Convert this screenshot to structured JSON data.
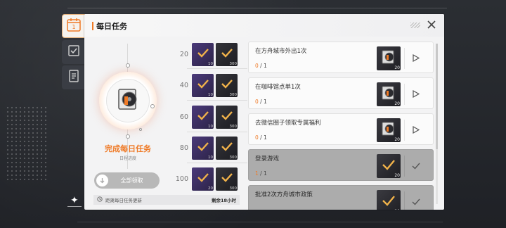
{
  "header": {
    "title": "每日任务"
  },
  "tabs": [
    {
      "name": "daily",
      "label": "1",
      "icon": "calendar-icon",
      "active": true
    },
    {
      "name": "weekly",
      "icon": "checklist-icon",
      "active": false
    },
    {
      "name": "record",
      "icon": "document-icon",
      "active": false
    }
  ],
  "left": {
    "complete_title": "完成每日任务",
    "complete_subtitle": "日程进度",
    "claim_all_label": "全部领取",
    "refresh_label": "距离每日任务更新",
    "remaining": "剩余18小时"
  },
  "milestones": [
    {
      "threshold": "20",
      "rewards": [
        {
          "style": "purple",
          "qty": "10",
          "claimed": true
        },
        {
          "style": "dark",
          "qty": "300",
          "claimed": true
        }
      ]
    },
    {
      "threshold": "40",
      "rewards": [
        {
          "style": "purple",
          "qty": "10",
          "claimed": true
        },
        {
          "style": "dark",
          "qty": "300",
          "claimed": true
        }
      ]
    },
    {
      "threshold": "60",
      "rewards": [
        {
          "style": "purple",
          "qty": "10",
          "claimed": true
        },
        {
          "style": "dark",
          "qty": "300",
          "claimed": true
        }
      ]
    },
    {
      "threshold": "80",
      "rewards": [
        {
          "style": "purple",
          "qty": "10",
          "claimed": true
        },
        {
          "style": "dark",
          "qty": "300",
          "claimed": true
        }
      ]
    },
    {
      "threshold": "100",
      "rewards": [
        {
          "style": "purple",
          "qty": "20",
          "claimed": true
        },
        {
          "style": "dark",
          "qty": "300",
          "claimed": true
        }
      ]
    }
  ],
  "tasks": [
    {
      "name": "在方舟城市外出1次",
      "current": "0",
      "total": "/ 1",
      "reward_qty": "20",
      "done": false
    },
    {
      "name": "在咖啡馆点单1次",
      "current": "0",
      "total": "/ 1",
      "reward_qty": "20",
      "done": false
    },
    {
      "name": "去微信圈子领取专属福利",
      "current": "0",
      "total": "/ 1",
      "reward_qty": "20",
      "done": false
    },
    {
      "name": "登录游戏",
      "current": "1",
      "total": "/ 1",
      "reward_qty": "20",
      "done": true
    },
    {
      "name": "批准2次方舟城市政策",
      "current": "",
      "total": "",
      "reward_qty": "20",
      "done": true
    }
  ],
  "colors": {
    "accent": "#ef7a26",
    "panel": "#f3f3f4",
    "done_row": "#acacac"
  }
}
